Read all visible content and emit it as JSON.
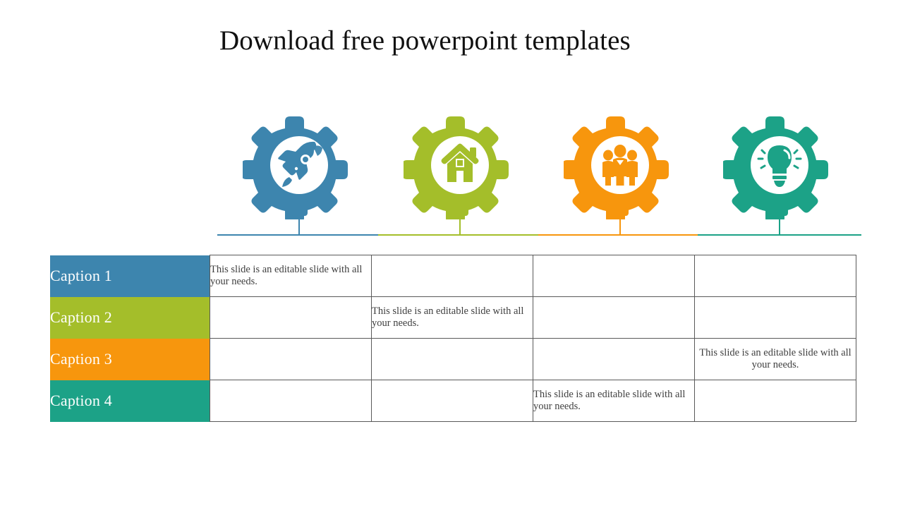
{
  "slide": {
    "title": "Download free powerpoint templates",
    "background": "#ffffff"
  },
  "palette": {
    "blue": "#3D85AE",
    "green": "#A4BE2A",
    "orange": "#F7960D",
    "teal": "#1CA287",
    "body_text": "#3f3f3f",
    "caption_text": "#ffffff",
    "table_border": "#595959",
    "title_text": "#111111"
  },
  "gears": [
    {
      "icon": "rocket-icon",
      "color": "#3D85AE",
      "label": "Caption 1"
    },
    {
      "icon": "house-icon",
      "color": "#A4BE2A",
      "label": "Caption 2"
    },
    {
      "icon": "team-icon",
      "color": "#F7960D",
      "label": "Caption 3"
    },
    {
      "icon": "lightbulb-icon",
      "color": "#1CA287",
      "label": "Caption 4"
    }
  ],
  "table": {
    "body_text": "This slide is an editable slide with all your needs.",
    "rows": [
      {
        "caption": "Caption 1",
        "color": "#3D85AE",
        "cells": [
          {
            "text": "This slide is an editable slide with all your needs.",
            "align": "left"
          },
          {
            "text": "",
            "align": "left"
          },
          {
            "text": "",
            "align": "left"
          },
          {
            "text": "",
            "align": "left"
          }
        ]
      },
      {
        "caption": "Caption 2",
        "color": "#A4BE2A",
        "cells": [
          {
            "text": "",
            "align": "left"
          },
          {
            "text": "This slide is an editable slide with all your needs.",
            "align": "left"
          },
          {
            "text": "",
            "align": "left"
          },
          {
            "text": "",
            "align": "left"
          }
        ]
      },
      {
        "caption": "Caption 3",
        "color": "#F7960D",
        "cells": [
          {
            "text": "",
            "align": "left"
          },
          {
            "text": "",
            "align": "left"
          },
          {
            "text": "",
            "align": "left"
          },
          {
            "text": "This slide is an editable slide with all your needs.",
            "align": "center"
          }
        ]
      },
      {
        "caption": "Caption 4",
        "color": "#1CA287",
        "cells": [
          {
            "text": "",
            "align": "left"
          },
          {
            "text": "",
            "align": "left"
          },
          {
            "text": "This slide is an editable slide with all your needs.",
            "align": "left"
          },
          {
            "text": "",
            "align": "left"
          }
        ]
      }
    ]
  }
}
